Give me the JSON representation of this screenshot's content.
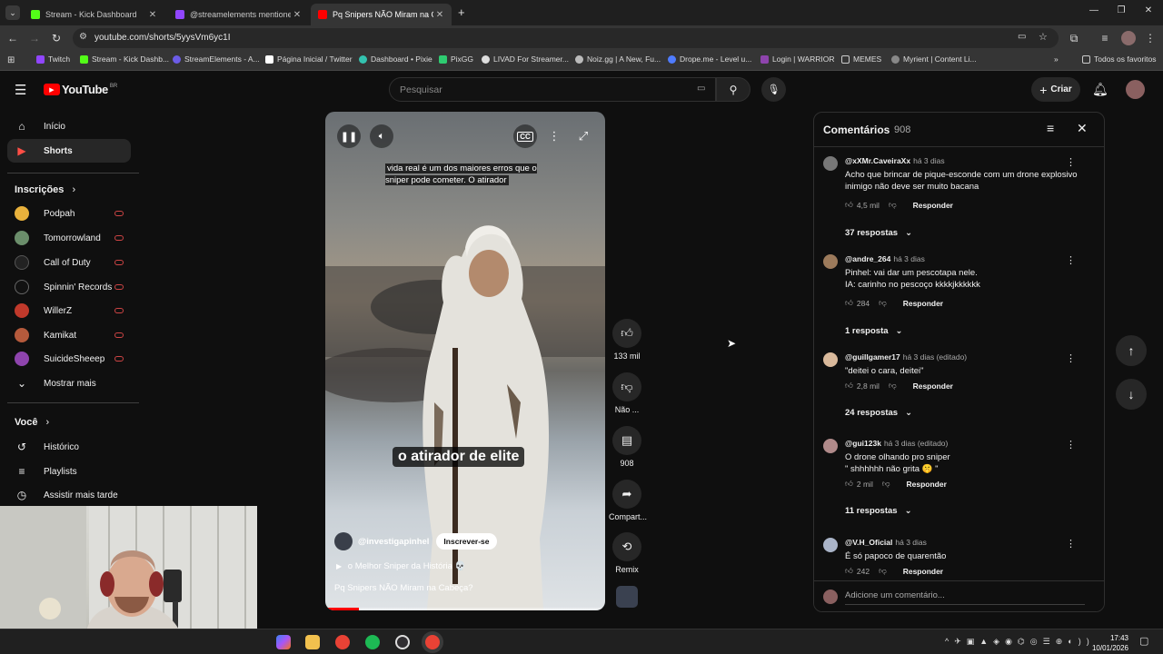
{
  "browser": {
    "tabs": [
      {
        "label": "Stream - Kick Dashboard",
        "color": "#53fc18",
        "active": false
      },
      {
        "label": "@streamelements mentione",
        "color": "#9146ff",
        "active": false
      },
      {
        "label": "Pq Snipers NÃO Miram na C",
        "color": "#ff0000",
        "active": true
      }
    ],
    "url": "youtube.com/shorts/5yysVm6yc1I",
    "bookmarks": [
      {
        "label": "Twitch",
        "color": "#9146ff"
      },
      {
        "label": "Stream - Kick Dashb...",
        "color": "#53fc18"
      },
      {
        "label": "StreamElements - A...",
        "color": "#6c5ce7"
      },
      {
        "label": "Página Inicial / Twitter",
        "color": "#ffffff"
      },
      {
        "label": "Dashboard • Pixie",
        "color": "#33c3b0"
      },
      {
        "label": "PixGG",
        "color": "#2ecc71"
      },
      {
        "label": "LIVAD For Streamer...",
        "color": "#dddddd"
      },
      {
        "label": "Noiz.gg | A New, Fu...",
        "color": "#bbbbbb"
      },
      {
        "label": "Drope.me - Level u...",
        "color": "#4f7cff"
      },
      {
        "label": "Login | WARRIOR",
        "color": "#8e44ad"
      },
      {
        "label": "MEMES",
        "color": "#cccccc"
      },
      {
        "label": "Myrient | Content Li...",
        "color": "#888888"
      }
    ],
    "all_bookmarks": "Todos os favoritos"
  },
  "youtube": {
    "logo": "YouTube",
    "region": "BR",
    "search_placeholder": "Pesquisar",
    "create_label": "Criar",
    "sidebar": {
      "main": [
        {
          "label": "Início",
          "icon": "home-icon"
        },
        {
          "label": "Shorts",
          "icon": "shorts-icon",
          "selected": true
        }
      ],
      "subscriptions_title": "Inscrições",
      "channels": [
        {
          "label": "Podpah",
          "color": "#e8b13c"
        },
        {
          "label": "Tomorrowland",
          "color": "#6b8e6b"
        },
        {
          "label": "Call of Duty",
          "color": "#222222"
        },
        {
          "label": "Spinnin' Records",
          "color": "#111111"
        },
        {
          "label": "WillerZ",
          "color": "#c0392b"
        },
        {
          "label": "Kamikat",
          "color": "#b55a3c"
        },
        {
          "label": "SuicideSheeep",
          "color": "#8e44ad"
        }
      ],
      "show_more": "Mostrar mais",
      "you_title": "Você",
      "you_items": [
        {
          "label": "Histórico",
          "icon": "history-icon"
        },
        {
          "label": "Playlists",
          "icon": "playlist-icon"
        },
        {
          "label": "Assistir mais tarde",
          "icon": "watch-later-icon"
        }
      ]
    },
    "short": {
      "caption_top": "vida real é um dos maiores erros que o sniper pode cometer. O atirador",
      "caption_mid": "o atirador de elite",
      "channel": "@investigapinhel",
      "subscribe": "Inscrever-se",
      "playlist": "o Melhor Sniper da História 💀",
      "title": "Pq Snipers NÃO Miram na Cabeça?",
      "progress": 0.12,
      "actions": [
        {
          "label": "133 mil",
          "icon": "like-icon"
        },
        {
          "label": "Não ...",
          "icon": "dislike-icon"
        },
        {
          "label": "908",
          "icon": "comment-icon"
        },
        {
          "label": "Compart...",
          "icon": "share-icon"
        },
        {
          "label": "Remix",
          "icon": "remix-icon"
        }
      ]
    },
    "comments": {
      "title": "Comentários",
      "count": "908",
      "items": [
        {
          "user": "@xXMr.CaveiraXx",
          "time": "há 3 dias",
          "text": "Acho que brincar de pique-esconde com um drone explosivo inimigo não deve ser muito bacana",
          "likes": "4,5 mil",
          "replies": "37 respostas",
          "avatar": "#777777"
        },
        {
          "user": "@andre_264",
          "time": "há 3 dias",
          "text": "Pinhel: vai dar um pescotapa nele.\nIA: carinho no pescoço kkkkjkkkkkk",
          "likes": "284",
          "replies": "1 resposta",
          "avatar": "#9c7a5b"
        },
        {
          "user": "@guillgamer17",
          "time": "há 3 dias (editado)",
          "text": "\"deitei o cara, deitei\"",
          "likes": "2,8 mil",
          "replies": "24 respostas",
          "avatar": "#d9b99b"
        },
        {
          "user": "@gui123k",
          "time": "há 3 dias (editado)",
          "text": "O drone olhando pro sniper\n\" shhhhhh não grita 🤫 \"",
          "likes": "2 mil",
          "replies": "11 respostas",
          "avatar": "#b08a8a"
        },
        {
          "user": "@V.H_Oficial",
          "time": "há 3 dias",
          "text": "É só papoco de quarentão",
          "likes": "242",
          "replies": "",
          "avatar": "#aab4c8"
        }
      ],
      "reply_label": "Responder",
      "input_placeholder": "Adicione um comentário..."
    }
  },
  "taskbar": {
    "time": "17:43",
    "date": "10/01/2026"
  }
}
